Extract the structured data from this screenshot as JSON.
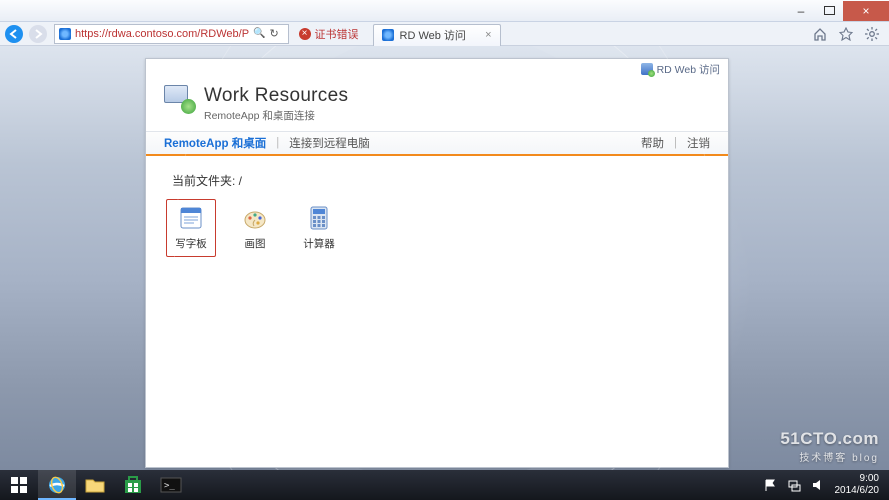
{
  "window": {
    "minimize_glyph": "–",
    "close_glyph": "×"
  },
  "browser": {
    "url_display": "https://rdwa.contoso.com/RDWeb/P",
    "refresh_glyph": "↻",
    "cert_error_label": "证书错误",
    "tab_title": "RD Web 访问",
    "tab_close_glyph": "×"
  },
  "rdweb": {
    "identity_label": "RD Web 访问",
    "title": "Work Resources",
    "subtitle": "RemoteApp 和桌面连接",
    "menu": {
      "remoteapp": "RemoteApp 和桌面",
      "connect_remote": "连接到远程电脑",
      "help": "帮助",
      "signout": "注销",
      "sep": "|"
    },
    "breadcrumb": "当前文件夹: /",
    "apps": [
      {
        "name": "wordpad",
        "label": "写字板"
      },
      {
        "name": "paint",
        "label": "画图"
      },
      {
        "name": "calculator",
        "label": "计算器"
      }
    ]
  },
  "tray": {
    "time": "9:00",
    "date": "2014/6/20"
  },
  "watermark": {
    "main": "51CTO.com",
    "sub": "技术博客 blog"
  }
}
